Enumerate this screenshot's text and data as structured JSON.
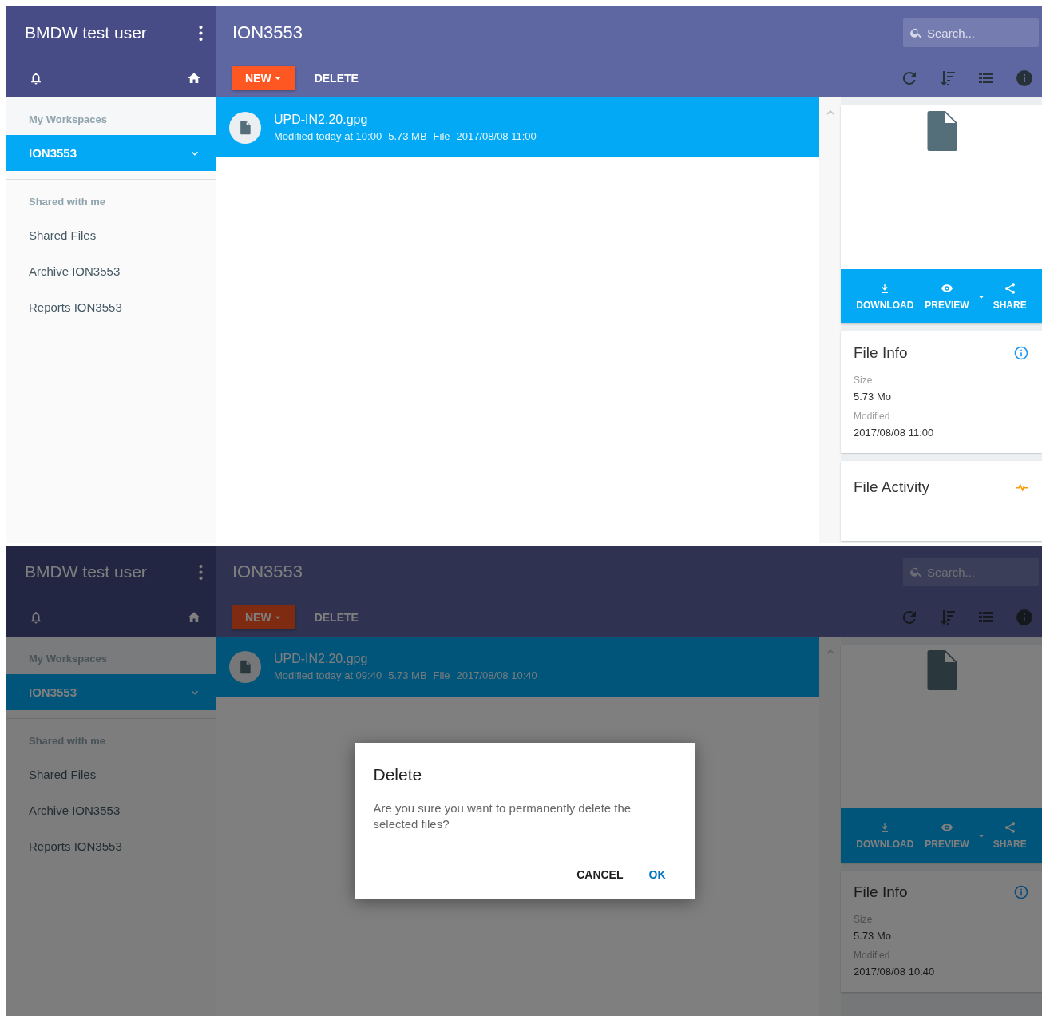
{
  "screens": [
    {
      "user": "BMDW test user",
      "title": "ION3553",
      "search": {
        "placeholder": "Search..."
      },
      "sidebar": [
        {
          "heading": "My Workspaces",
          "items": [
            {
              "label": "ION3553",
              "kind": "workspace",
              "selected": true
            }
          ]
        },
        {
          "heading": "Shared with me",
          "items": [
            {
              "label": "Shared Files",
              "kind": "link",
              "selected": false
            },
            {
              "label": "Archive ION3553",
              "kind": "link",
              "selected": false
            },
            {
              "label": "Reports ION3553",
              "kind": "link",
              "selected": false
            }
          ]
        }
      ],
      "toolbar": [
        "NEW",
        "DELETE"
      ],
      "files": [
        {
          "name": "UPD-IN2.20.gpg",
          "details": [
            "Modified today at 10:00",
            "5.73 MB",
            "File",
            "2017/08/08 11:00"
          ],
          "selected": true
        }
      ],
      "actions": [
        "DOWNLOAD",
        "PREVIEW",
        "SHARE"
      ],
      "file_info": {
        "title": "File Info",
        "fields": [
          {
            "label": "Size",
            "value": "5.73 Mo"
          },
          {
            "label": "Modified",
            "value": "2017/08/08 11:00"
          }
        ]
      },
      "file_activity": {
        "title": "File Activity"
      }
    },
    {
      "user": "BMDW test user",
      "title": "ION3553",
      "search": {
        "placeholder": "Search..."
      },
      "sidebar": [
        {
          "heading": "My Workspaces",
          "items": [
            {
              "label": "ION3553",
              "kind": "workspace",
              "selected": true
            }
          ]
        },
        {
          "heading": "Shared with me",
          "items": [
            {
              "label": "Shared Files",
              "kind": "link",
              "selected": false
            },
            {
              "label": "Archive ION3553",
              "kind": "link",
              "selected": false
            },
            {
              "label": "Reports ION3553",
              "kind": "link",
              "selected": false
            }
          ]
        }
      ],
      "toolbar": [
        "NEW",
        "DELETE"
      ],
      "files": [
        {
          "name": "UPD-IN2.20.gpg",
          "details": [
            "Modified today at 09:40",
            "5.73 MB",
            "File",
            "2017/08/08 10:40"
          ],
          "selected": true
        }
      ],
      "actions": [
        "DOWNLOAD",
        "PREVIEW",
        "SHARE"
      ],
      "file_info": {
        "title": "File Info",
        "fields": [
          {
            "label": "Size",
            "value": "5.73 Mo"
          },
          {
            "label": "Modified",
            "value": "2017/08/08 10:40"
          }
        ]
      },
      "dialog": {
        "title": "Delete",
        "message": "Are you sure you want to permanently delete the selected files?",
        "buttons": [
          "CANCEL",
          "OK"
        ]
      }
    }
  ]
}
